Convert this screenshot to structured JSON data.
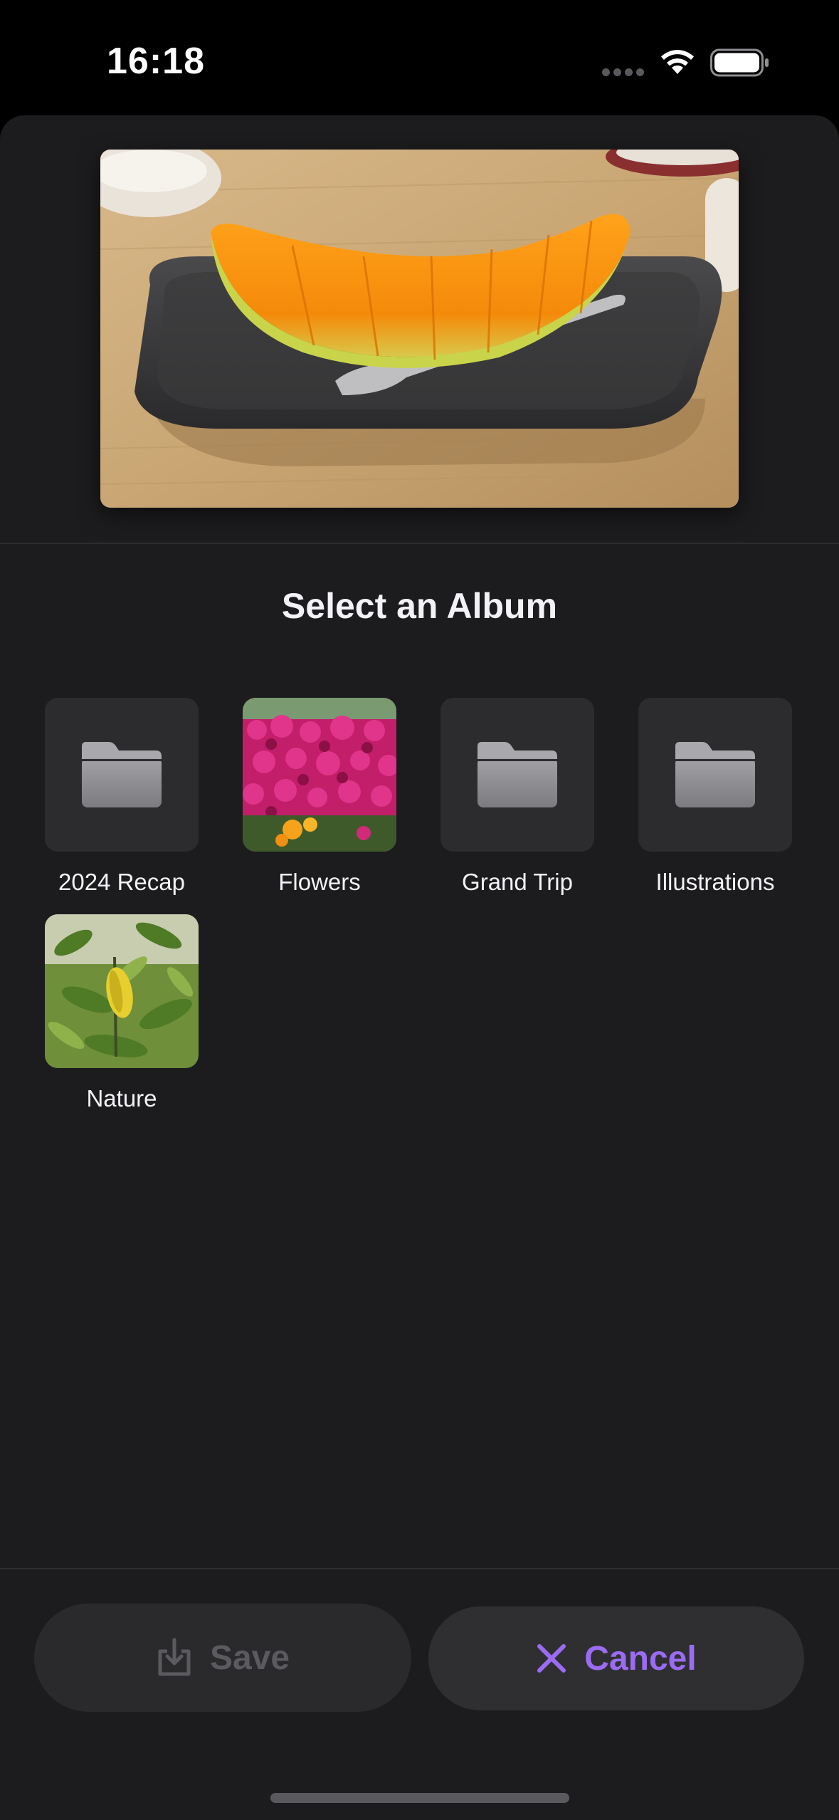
{
  "status_bar": {
    "time": "16:18"
  },
  "sheet": {
    "title": "Select an Album"
  },
  "albums": [
    {
      "label": "2024 Recap",
      "thumbnail": "folder-icon"
    },
    {
      "label": "Flowers",
      "thumbnail": "flowers-photo"
    },
    {
      "label": "Grand Trip",
      "thumbnail": "folder-icon"
    },
    {
      "label": "Illustrations",
      "thumbnail": "folder-icon"
    },
    {
      "label": "Nature",
      "thumbnail": "nature-photo"
    }
  ],
  "actions": {
    "save_label": "Save",
    "save_icon": "save-to-tray-icon",
    "cancel_label": "Cancel",
    "cancel_icon": "close-icon"
  },
  "colors": {
    "background": "#1c1c1e",
    "accent": "#9b6cf3",
    "disabled": "#5a5a5f"
  }
}
